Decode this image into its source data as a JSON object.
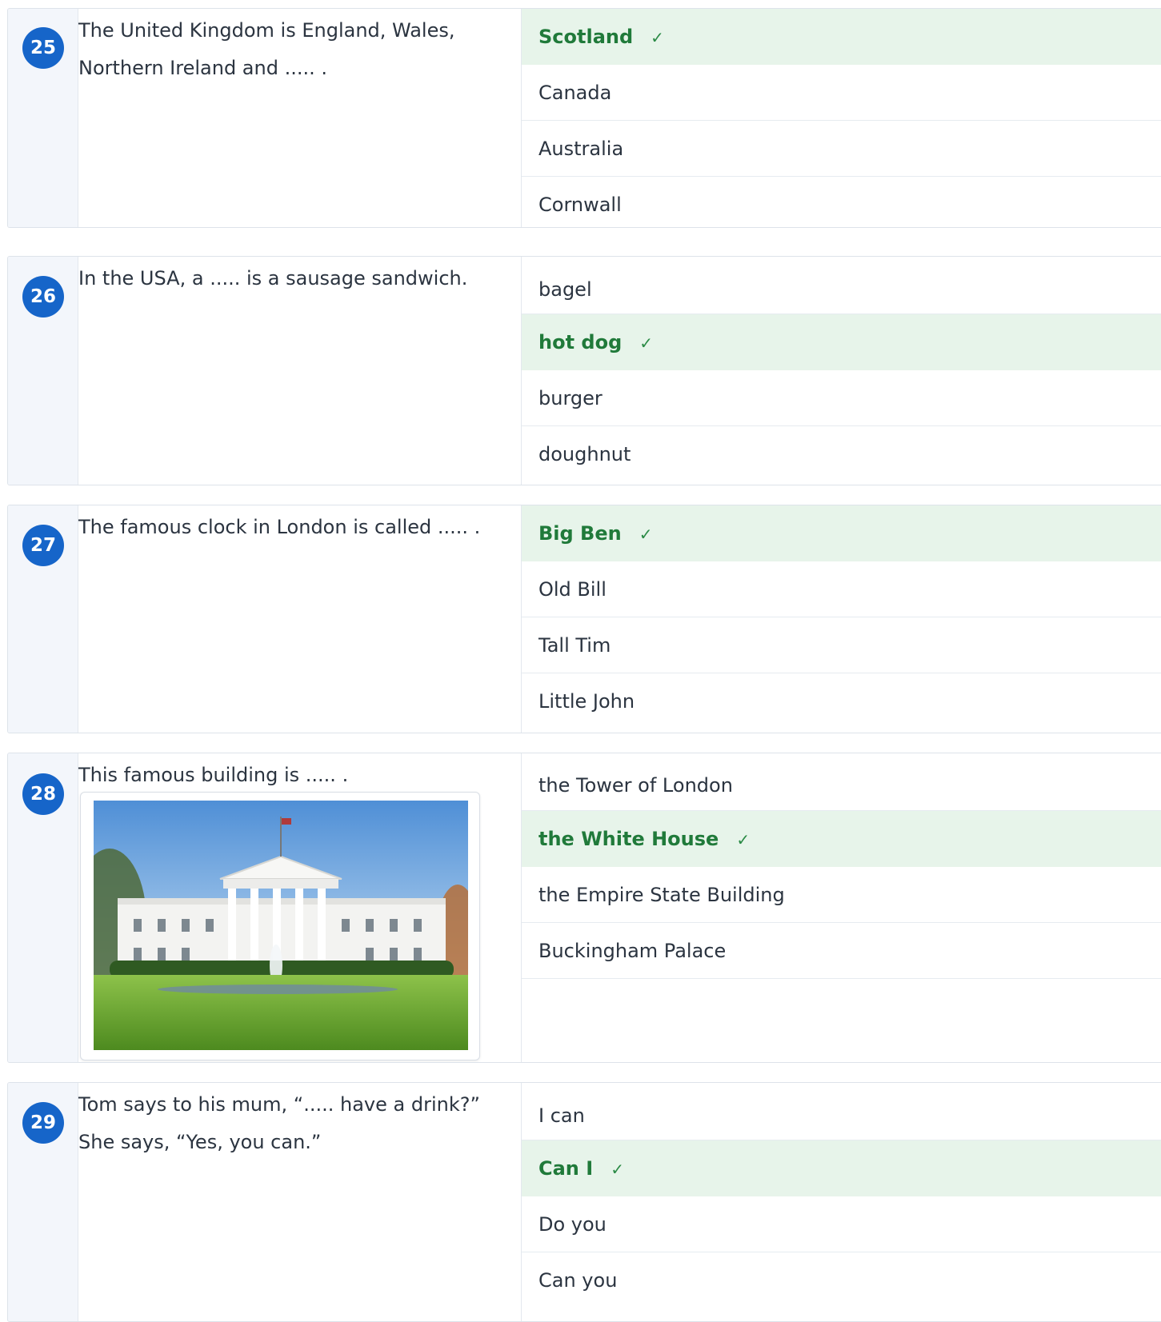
{
  "questions": [
    {
      "number": "25",
      "prompt_lines": [
        "The United Kingdom is England, Wales,",
        "Northern Ireland and ..... ."
      ],
      "answers": [
        {
          "label": "Scotland",
          "correct": true
        },
        {
          "label": "Canada",
          "correct": false
        },
        {
          "label": "Australia",
          "correct": false
        },
        {
          "label": "Cornwall",
          "correct": false
        }
      ]
    },
    {
      "number": "26",
      "prompt_lines": [
        "In the USA, a ..... is a sausage sandwich."
      ],
      "answers": [
        {
          "label": "bagel",
          "correct": false
        },
        {
          "label": "hot dog",
          "correct": true
        },
        {
          "label": "burger",
          "correct": false
        },
        {
          "label": "doughnut",
          "correct": false
        }
      ]
    },
    {
      "number": "27",
      "prompt_lines": [
        "The famous clock in London is called ..... ."
      ],
      "answers": [
        {
          "label": "Big Ben",
          "correct": true
        },
        {
          "label": "Old Bill",
          "correct": false
        },
        {
          "label": "Tall Tim",
          "correct": false
        },
        {
          "label": "Little John",
          "correct": false
        }
      ]
    },
    {
      "number": "28",
      "prompt_lines": [
        "This famous building is ..... ."
      ],
      "image": "white-house-photo",
      "answers": [
        {
          "label": "the Tower of London",
          "correct": false
        },
        {
          "label": "the White House",
          "correct": true
        },
        {
          "label": "the Empire State Building",
          "correct": false
        },
        {
          "label": "Buckingham Palace",
          "correct": false
        }
      ]
    },
    {
      "number": "29",
      "prompt_lines": [
        "Tom says to his mum, “..... have a drink?”",
        "She says, “Yes, you can.”"
      ],
      "answers": [
        {
          "label": "I can",
          "correct": false
        },
        {
          "label": "Can I",
          "correct": true
        },
        {
          "label": "Do you",
          "correct": false
        },
        {
          "label": "Can you",
          "correct": false
        }
      ]
    }
  ],
  "check_mark": "✓",
  "colors": {
    "badge": "#1665c9",
    "correct_bg": "#e7f4ea",
    "correct_text": "#207a3a",
    "number_column_bg": "#f3f6fb"
  }
}
